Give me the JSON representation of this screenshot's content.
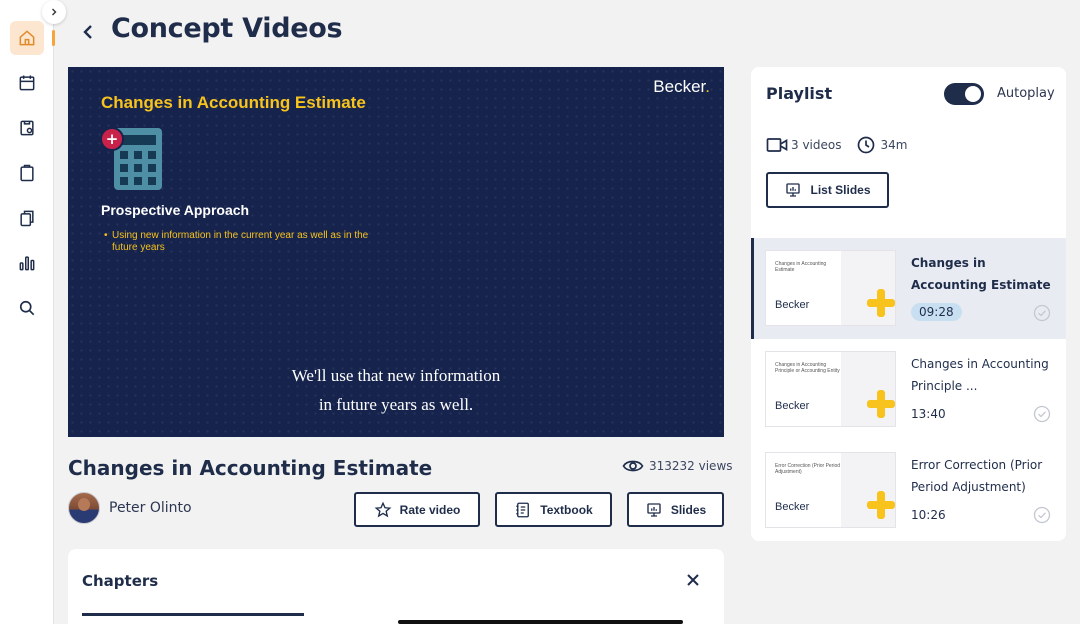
{
  "page": {
    "title": "Concept Videos"
  },
  "sidebar": {
    "items": [
      {
        "name": "home-icon",
        "active": true
      },
      {
        "name": "calendar-icon",
        "active": false
      },
      {
        "name": "study-plan-icon",
        "active": false
      },
      {
        "name": "clipboard-icon",
        "active": false
      },
      {
        "name": "flashcards-icon",
        "active": false
      },
      {
        "name": "bar-chart-icon",
        "active": false
      },
      {
        "name": "search-icon",
        "active": false
      }
    ]
  },
  "video": {
    "brand": "Becker",
    "slide_title": "Changes in Accounting Estimate",
    "slide_heading": "Prospective Approach",
    "slide_bullet": "Using new information in the current year as well as in the future years",
    "caption_line1": "We'll use that new information",
    "caption_line2": "in future years as well."
  },
  "info": {
    "title": "Changes in Accounting Estimate",
    "views": "313232 views",
    "author": "Peter Olinto"
  },
  "actions": {
    "rate_label": "Rate video",
    "textbook_label": "Textbook",
    "slides_label": "Slides"
  },
  "chapters": {
    "title": "Chapters"
  },
  "playlist": {
    "title": "Playlist",
    "autoplay_label": "Autoplay",
    "autoplay_on": true,
    "video_count": "3 videos",
    "total_duration": "34m",
    "list_slides_label": "List Slides",
    "items": [
      {
        "thumb_text": "Changes in Accounting Estimate",
        "thumb_logo": "Becker",
        "title": "Changes in Accounting Estimate",
        "duration": "09:28",
        "active": true
      },
      {
        "thumb_text": "Changes in Accounting Principle or Accounting Entity",
        "thumb_logo": "Becker",
        "title": "Changes in Accounting Principle ...",
        "duration": "13:40",
        "active": false
      },
      {
        "thumb_text": "Error Correction (Prior Period Adjustment)",
        "thumb_logo": "Becker",
        "title": "Error Correction (Prior Period Adjustment)",
        "duration": "10:26",
        "active": false
      }
    ]
  },
  "colors": {
    "navy": "#1f2d4a",
    "video_bg": "#16234d",
    "accent_yellow": "#f7c31c",
    "active_nav_bg": "#fce6cf",
    "active_item_bg": "#e8ecf2"
  }
}
